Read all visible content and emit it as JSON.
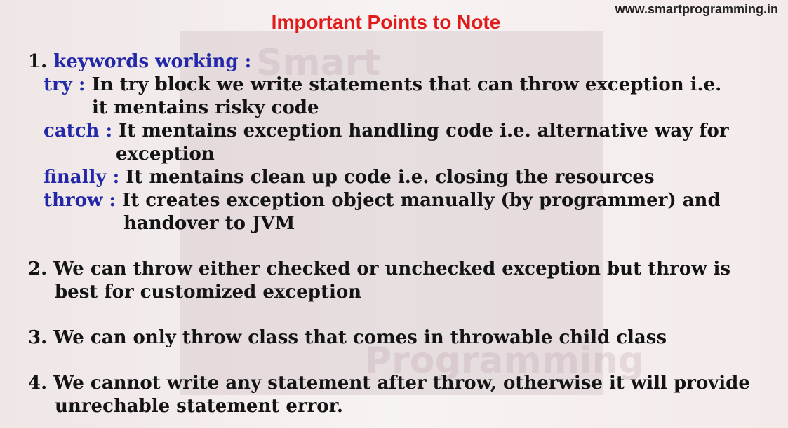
{
  "site": {
    "url": "www.smartprogramming.in"
  },
  "heading": "Important Points to Note",
  "points": {
    "p1": {
      "number": "1.",
      "title": "keywords working :",
      "try": {
        "keyword": "try :",
        "line1": "In try block we write statements that can throw exception i.e.",
        "line2": "it mentains risky code"
      },
      "catch": {
        "keyword": "catch :",
        "line1": "It mentains exception handling code i.e. alternative way for",
        "line2": "exception"
      },
      "finally": {
        "keyword": "finally :",
        "line1": "It mentains clean up code i.e. closing the resources"
      },
      "throw": {
        "keyword": "throw :",
        "line1": "It creates exception object manually (by programmer) and",
        "line2": "handover to JVM"
      }
    },
    "p2": {
      "number": "2.",
      "line1": "We can throw either checked or unchecked exception but throw is",
      "line2": "best for customized exception"
    },
    "p3": {
      "number": "3.",
      "line1": "We can only throw class that comes in throwable child class"
    },
    "p4": {
      "number": "4.",
      "line1": "We cannot write any statement after throw, otherwise it will provide",
      "line2": "unrechable statement error."
    }
  },
  "watermark": {
    "top_word": "Smart",
    "bottom_word": "Programming"
  },
  "colors": {
    "heading": "#e11b1b",
    "keyword": "#2328a8",
    "text": "#141414"
  }
}
